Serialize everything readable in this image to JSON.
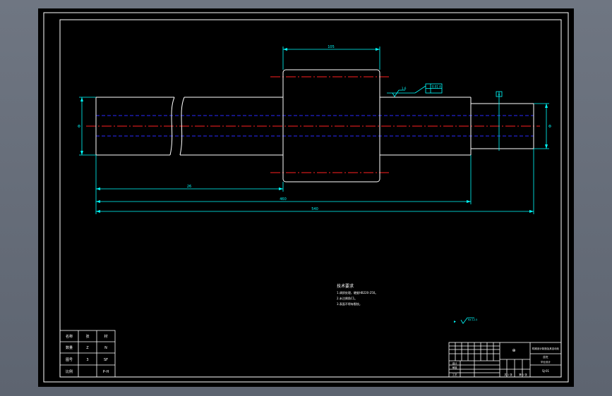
{
  "colors": {
    "background": "#000000",
    "frame": "#ffffff",
    "outline": "#00ffff",
    "centerline": "#ff2020",
    "hidden_line": "#2a2aff"
  },
  "dimensions": {
    "top_width": "105",
    "left_length": "26",
    "mid_length": "460",
    "overall_length": "540",
    "left_diameter": "Φ",
    "right_diameter": "Φ"
  },
  "annotations": {
    "surface_finish": "1.6",
    "tolerance_frame": "0.01 A",
    "datum": "A",
    "corner_finish": "Ra 12.5"
  },
  "tech_req": {
    "title": "技术要求",
    "items": [
      "1.调质处理，硬度HB220-250。",
      "2.未注倒角C1。",
      "3.表面不得有裂纹。"
    ]
  },
  "left_block": {
    "rows": [
      [
        "名称",
        "张",
        "材"
      ],
      [
        "数量",
        "Z",
        "N"
      ],
      [
        "图号",
        "3",
        "SF"
      ],
      [
        "比例",
        "",
        "P-H"
      ]
    ]
  },
  "title_block": {
    "symbol": "⊕",
    "company": "机械设计制造及其自动化",
    "part": "丝杠",
    "drawing_name": "毕业设计",
    "number": "SJ-01",
    "row_labels": [
      "设计",
      "审核",
      "工艺"
    ],
    "footer": [
      "共 1 张",
      "第 1 张"
    ]
  }
}
